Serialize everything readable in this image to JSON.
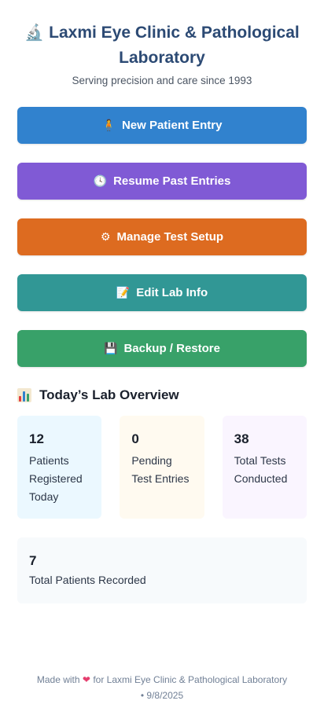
{
  "header": {
    "title_icon": "microscope-icon",
    "title": "Laxmi Eye Clinic & Pathological Laboratory",
    "subtitle": "Serving precision and care since 1993"
  },
  "actions": [
    {
      "label": "New Patient Entry",
      "icon": "person-icon",
      "color": "#3182ce"
    },
    {
      "label": "Resume Past Entries",
      "icon": "clock-icon",
      "color": "#805ad5"
    },
    {
      "label": "Manage Test Setup",
      "icon": "gear-icon",
      "color": "#dd6b20"
    },
    {
      "label": "Edit Lab Info",
      "icon": "document-icon",
      "color": "#319795"
    },
    {
      "label": "Backup / Restore",
      "icon": "floppy-disk-icon",
      "color": "#38a169"
    }
  ],
  "overview": {
    "title": "Today’s Lab Overview",
    "icon": "bar-chart-icon",
    "stats": [
      {
        "value": "12",
        "label": "Patients Registered Today"
      },
      {
        "value": "0",
        "label": "Pending Test Entries"
      },
      {
        "value": "38",
        "label": "Total Tests Conducted"
      }
    ],
    "total": {
      "value": "7",
      "label": "Total Patients Recorded"
    }
  },
  "footer": {
    "prefix": "Made with",
    "heart_icon": "heart-icon",
    "suffix": "for Laxmi Eye Clinic & Pathological Laboratory",
    "date_line": "• 9/8/2025"
  }
}
